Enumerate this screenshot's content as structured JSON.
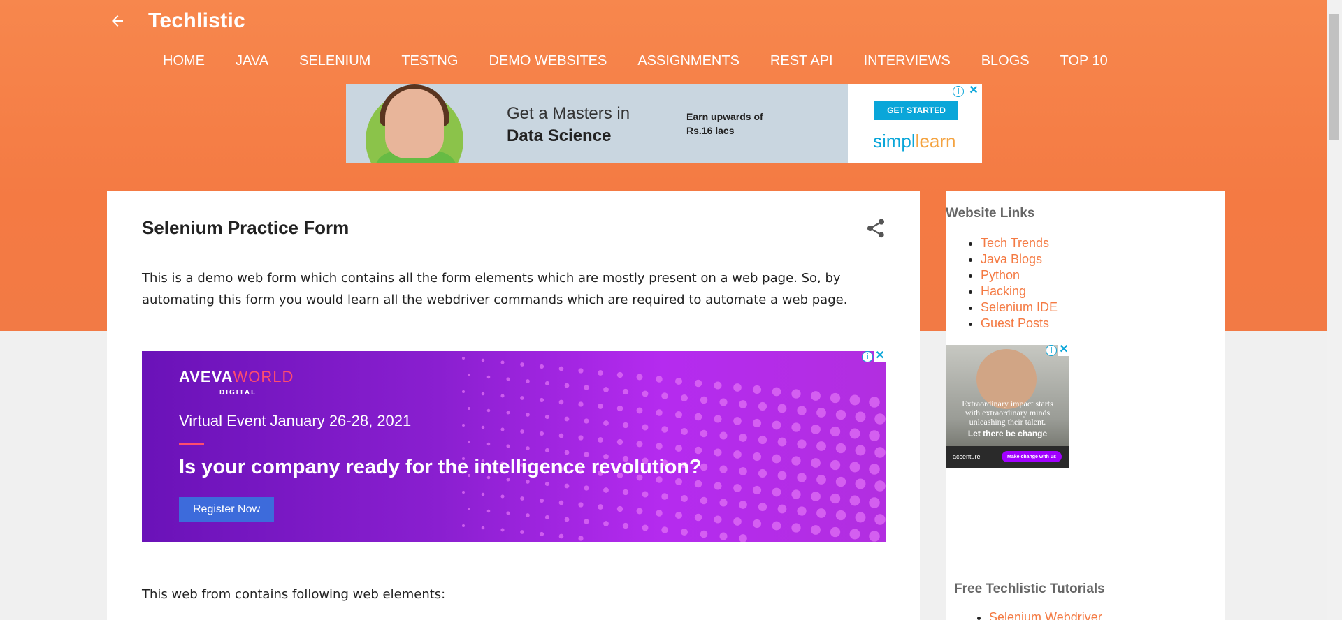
{
  "header": {
    "site_title": "Techlistic",
    "back_icon": "arrow-left-icon",
    "nav": [
      "HOME",
      "JAVA",
      "SELENIUM",
      "TESTNG",
      "DEMO WEBSITES",
      "ASSIGNMENTS",
      "REST API",
      "INTERVIEWS",
      "BLOGS",
      "TOP 10"
    ]
  },
  "ads": {
    "top": {
      "line1": "Get a Masters in",
      "line2": "Data Science",
      "earn1": "Earn upwards of",
      "earn2": "Rs.16 lacs",
      "cta": "GET STARTED",
      "brand_a": "simpl",
      "brand_b": "learn"
    },
    "mid": {
      "logo_a": "AVEVA",
      "logo_b": "WORLD",
      "digital": "DIGITAL",
      "event": "Virtual Event January 26-28, 2021",
      "headline": "Is your company ready for the intelligence revolution?",
      "button": "Register Now"
    },
    "side": {
      "text1": "Extraordinary impact starts",
      "text2": "with extraordinary minds",
      "text3": "unleashing their talent.",
      "tagline": "Let there be change",
      "brand": "accenture",
      "pill": "Make change with us"
    },
    "info_glyph": "i",
    "close_glyph": "✕"
  },
  "post": {
    "title": "Selenium Practice Form",
    "intro": "This is a demo web form which contains all the form elements which are mostly present on a web page. So, by automating this form you would learn all the webdriver commands which are required to automate a web page.",
    "list_intro": "This web from contains following web elements:"
  },
  "sidebar": {
    "title": "Website Links",
    "links": [
      "Tech Trends",
      "Java Blogs",
      "Python",
      "Hacking",
      "Selenium IDE",
      "Guest Posts"
    ],
    "title2": "Free Techlistic Tutorials",
    "links2": [
      "Selenium Webdriver"
    ]
  },
  "colors": {
    "accent": "#f47a43",
    "link": "#f47a43"
  }
}
